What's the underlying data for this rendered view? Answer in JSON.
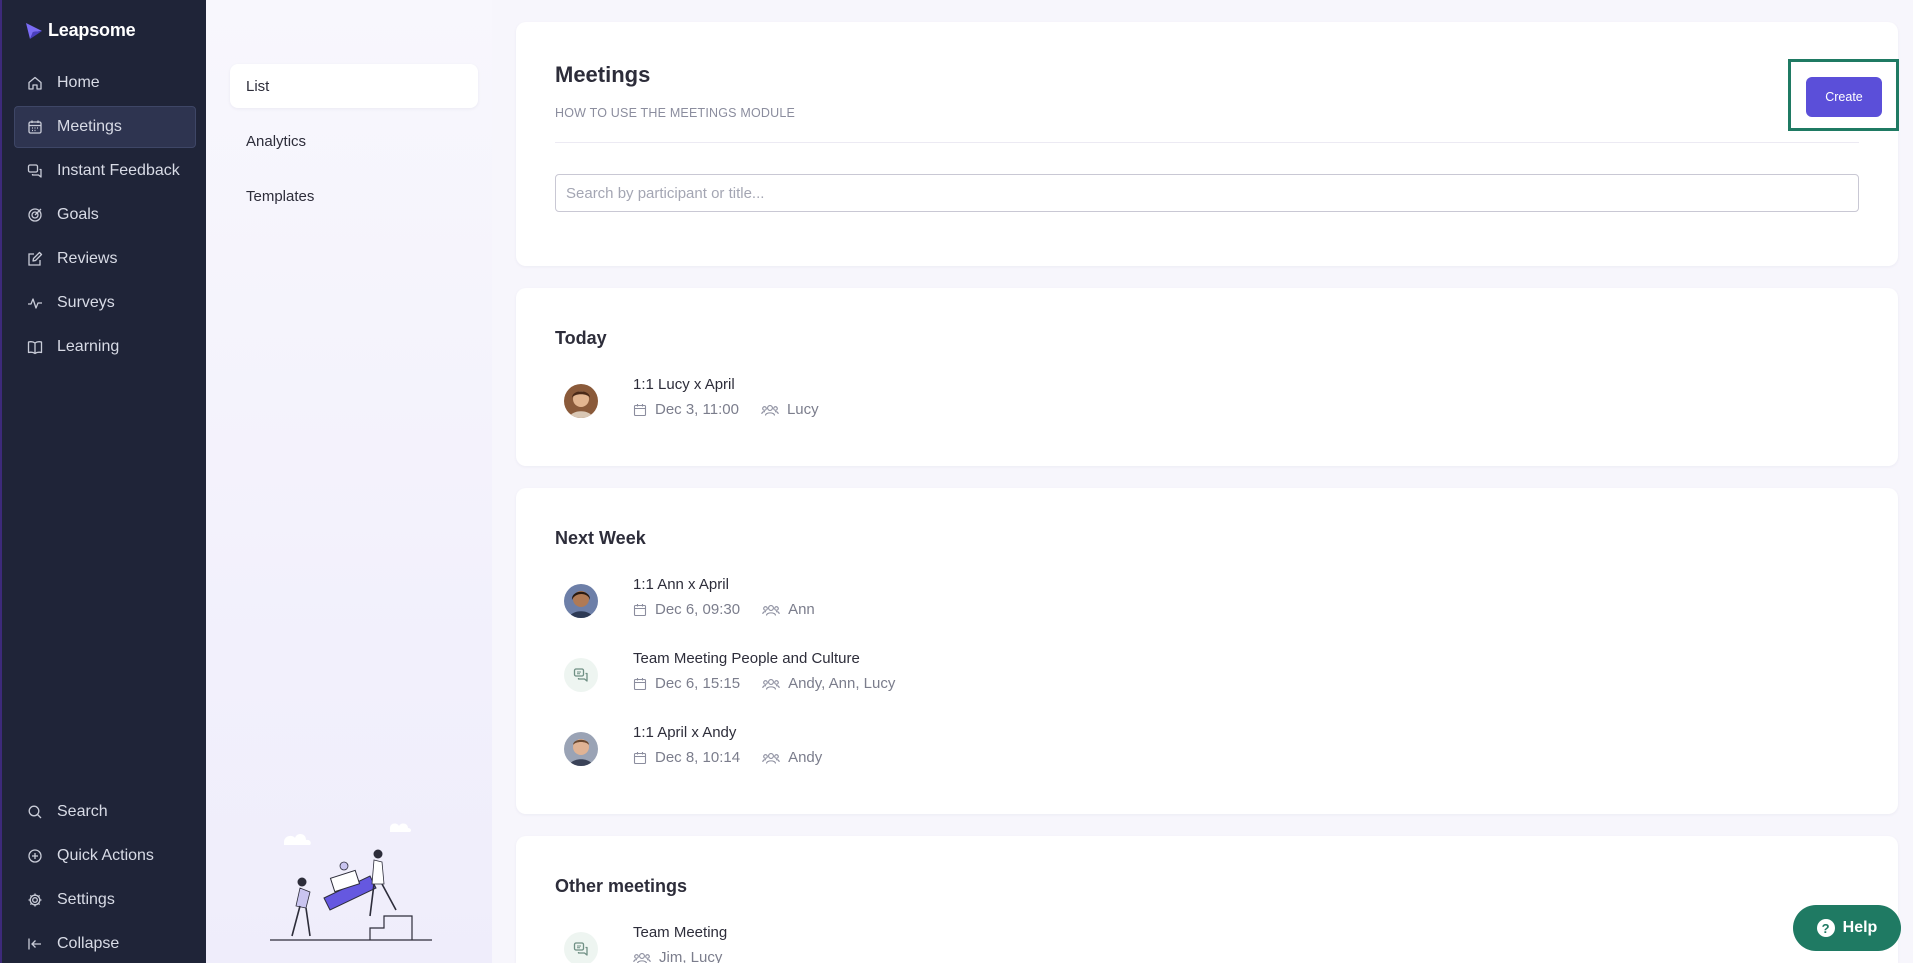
{
  "brand": {
    "name": "Leapsome"
  },
  "sidebar": {
    "items": [
      {
        "label": "Home",
        "icon": "home-icon"
      },
      {
        "label": "Meetings",
        "icon": "calendar-icon",
        "active": true
      },
      {
        "label": "Instant Feedback",
        "icon": "chat-icon"
      },
      {
        "label": "Goals",
        "icon": "target-icon"
      },
      {
        "label": "Reviews",
        "icon": "edit-icon"
      },
      {
        "label": "Surveys",
        "icon": "pulse-icon"
      },
      {
        "label": "Learning",
        "icon": "book-icon"
      }
    ],
    "bottom_items": [
      {
        "label": "Search",
        "icon": "search-icon"
      },
      {
        "label": "Quick Actions",
        "icon": "plus-circle-icon"
      },
      {
        "label": "Settings",
        "icon": "gear-icon"
      },
      {
        "label": "Collapse",
        "icon": "collapse-icon"
      }
    ]
  },
  "submenu": {
    "items": [
      {
        "label": "List",
        "active": true
      },
      {
        "label": "Analytics"
      },
      {
        "label": "Templates"
      }
    ]
  },
  "header": {
    "title": "Meetings",
    "howto": "HOW TO USE THE MEETINGS MODULE",
    "create_label": "Create",
    "search_placeholder": "Search by participant or title..."
  },
  "sections": [
    {
      "title": "Today",
      "meetings": [
        {
          "title": "1:1 Lucy x April",
          "date": "Dec 3, 11:00",
          "participants": "Lucy",
          "avatar": "photo"
        }
      ]
    },
    {
      "title": "Next Week",
      "meetings": [
        {
          "title": "1:1 Ann x April",
          "date": "Dec 6, 09:30",
          "participants": "Ann",
          "avatar": "photo"
        },
        {
          "title": "Team Meeting People and Culture",
          "date": "Dec 6, 15:15",
          "participants": "Andy, Ann, Lucy",
          "avatar": "chat-icon"
        },
        {
          "title": "1:1 April x Andy",
          "date": "Dec 8, 10:14",
          "participants": "Andy",
          "avatar": "photo"
        }
      ]
    },
    {
      "title": "Other meetings",
      "meetings": [
        {
          "title": "Team Meeting",
          "participants": "Jim, Lucy",
          "avatar": "chat-icon"
        }
      ]
    }
  ],
  "help": {
    "label": "Help"
  },
  "colors": {
    "sidebar_bg": "#1f2438",
    "accent": "#5b4fd9",
    "help_bg": "#1f7a63",
    "highlight_border": "#1f7a63"
  }
}
